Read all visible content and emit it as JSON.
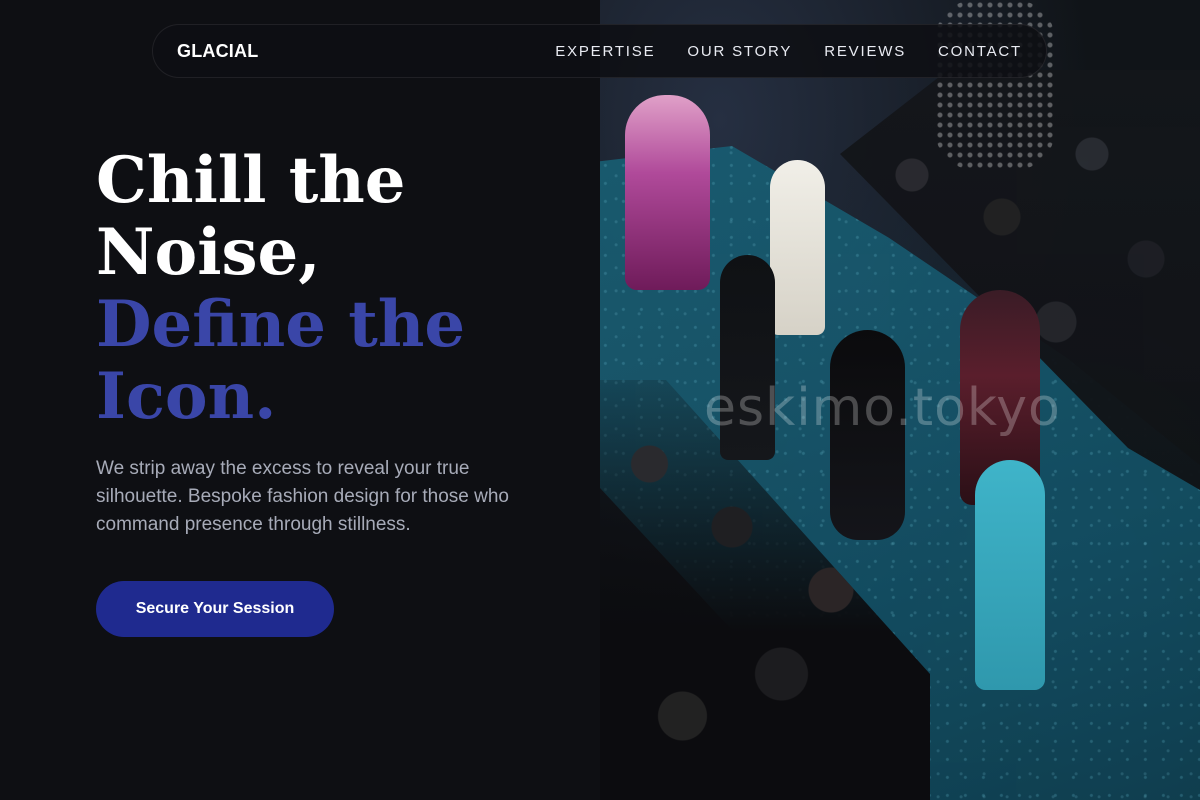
{
  "nav": {
    "brand": "GLACIAL",
    "links": [
      {
        "label": "EXPERTISE"
      },
      {
        "label": "OUR STORY"
      },
      {
        "label": "REVIEWS"
      },
      {
        "label": "CONTACT"
      }
    ]
  },
  "hero": {
    "headline": {
      "line1": "Chill the",
      "line2": "Noise,",
      "line3": "Define the",
      "line4": "Icon."
    },
    "subtext": "We strip away the excess to reveal your true silhouette. Bespoke fashion design for those who command presence through stillness.",
    "cta_label": "Secure Your Session"
  },
  "photo": {
    "watermark": "eskimo.tokyo"
  },
  "colors": {
    "background": "#0e0f13",
    "accent": "#3a46a8",
    "button": "#1f2a8f",
    "body_text": "#a7abb8"
  }
}
